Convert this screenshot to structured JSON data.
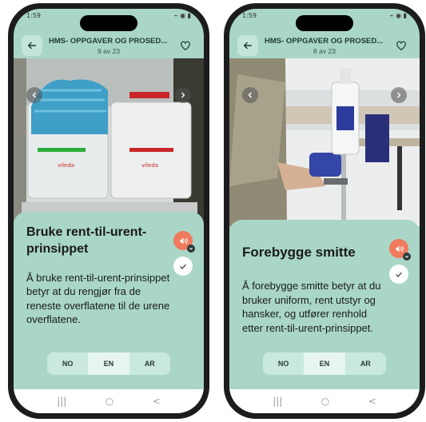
{
  "phones": [
    {
      "status": {
        "time": "1:59",
        "icons": "⌁ ◉ ▮"
      },
      "header": {
        "title": "HMS- OPPGAVER OG PROSED...",
        "subtitle": "9 av 23"
      },
      "card": {
        "title": "Bruke rent-til-urent-prinsippet",
        "body": "Å bruke rent-til-urent-prinsippet betyr at du rengjør fra de reneste overflatene til de urene overflatene."
      },
      "languages": [
        "NO",
        "EN",
        "AR"
      ],
      "active_language": "EN",
      "navbar": {
        "menu": "|||",
        "home": "○",
        "back": "<"
      }
    },
    {
      "status": {
        "time": "1:59",
        "icons": "⌁ ◉ ▮"
      },
      "header": {
        "title": "HMS- OPPGAVER OG PROSED...",
        "subtitle": "8 av 23"
      },
      "card": {
        "title": "Forebygge smitte",
        "body": "Å forebygge smitte betyr at du bruker uniform, rent utstyr og hansker, og utfører renhold etter rent-til-urent-prinsippet."
      },
      "languages": [
        "NO",
        "EN",
        "AR"
      ],
      "active_language": "EN",
      "navbar": {
        "menu": "|||",
        "home": "○",
        "back": "<"
      }
    }
  ],
  "colors": {
    "background": "#a9d6c6",
    "accent": "#ef7a5e",
    "lang_bar": "#c9e9dd"
  }
}
